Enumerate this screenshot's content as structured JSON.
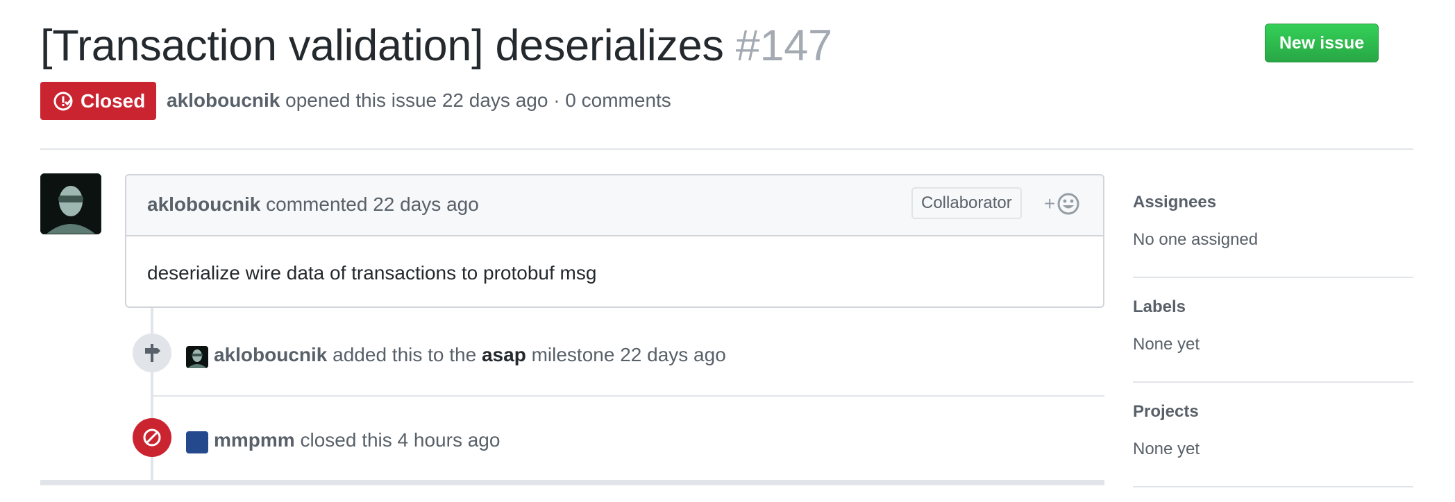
{
  "issue": {
    "title": "[Transaction validation] deserializes",
    "number": "#147",
    "state": "Closed",
    "author": "akloboucnik",
    "opened_text": " opened this issue 22 days ago · 0 comments"
  },
  "actions": {
    "new_issue": "New issue"
  },
  "comment": {
    "author": "akloboucnik",
    "action_text": " commented 22 days ago",
    "role_badge": "Collaborator",
    "reaction_plus": "+",
    "body": "deserialize wire data of transactions to protobuf msg"
  },
  "events": [
    {
      "actor": "akloboucnik",
      "text_before": " added this to the ",
      "milestone": "asap",
      "text_after": " milestone 22 days ago",
      "icon": "milestone-icon"
    },
    {
      "actor": "mmpmm",
      "text_after": " closed this 4 hours ago",
      "icon": "circle-slash-icon"
    }
  ],
  "sidebar": {
    "assignees": {
      "heading": "Assignees",
      "value": "No one assigned"
    },
    "labels": {
      "heading": "Labels",
      "value": "None yet"
    },
    "projects": {
      "heading": "Projects",
      "value": "None yet"
    }
  },
  "colors": {
    "closed_red": "#cb2431",
    "new_issue_green": "#28a745",
    "muted_text": "#586069",
    "border": "#e1e4e8"
  }
}
